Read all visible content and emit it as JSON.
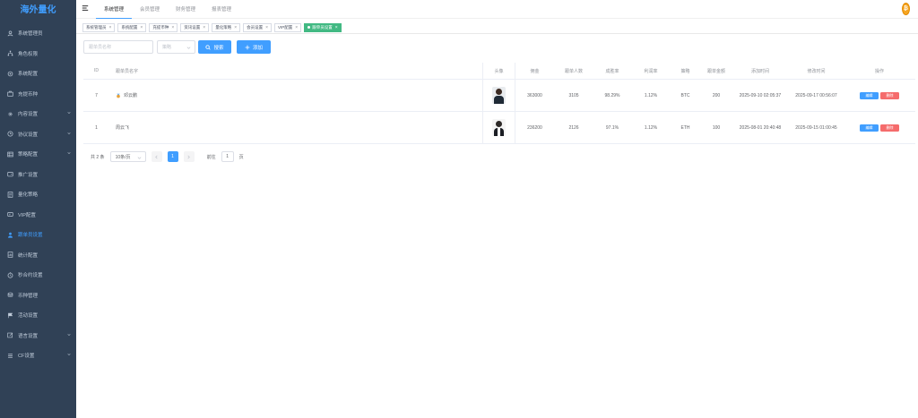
{
  "app": {
    "logo": "海外量化"
  },
  "sidebar": {
    "items": [
      {
        "label": "系统管理员",
        "icon": "user-icon"
      },
      {
        "label": "角色权限",
        "icon": "sitemap-icon"
      },
      {
        "label": "系统配置",
        "icon": "settings-icon"
      },
      {
        "label": "充提币种",
        "icon": "briefcase-icon"
      },
      {
        "label": "内容设置",
        "icon": "gear-icon"
      },
      {
        "label": "协议设置",
        "icon": "clock-icon"
      },
      {
        "label": "策略配置",
        "icon": "table-icon"
      },
      {
        "label": "推广设置",
        "icon": "wallet-icon"
      },
      {
        "label": "量化策略",
        "icon": "list-icon"
      },
      {
        "label": "VIP配置",
        "icon": "vip-icon"
      },
      {
        "label": "跟单员设置",
        "icon": "person-icon"
      },
      {
        "label": "统计配置",
        "icon": "chart-icon"
      },
      {
        "label": "秒合约设置",
        "icon": "timer-icon"
      },
      {
        "label": "币种管理",
        "icon": "coins-icon"
      },
      {
        "label": "活动设置",
        "icon": "flag-icon"
      },
      {
        "label": "语言设置",
        "icon": "edit-icon"
      },
      {
        "label": "CF设置",
        "icon": "menu-icon"
      }
    ]
  },
  "header": {
    "tabs": [
      "系统管理",
      "会员管理",
      "财务管理",
      "报表管理"
    ],
    "avatar_text": "₿"
  },
  "tags": [
    {
      "label": "系统管理员"
    },
    {
      "label": "系统配置"
    },
    {
      "label": "充提币种"
    },
    {
      "label": "资讯设置"
    },
    {
      "label": "量化策略"
    },
    {
      "label": "会员设置"
    },
    {
      "label": "VIP配置"
    },
    {
      "label": "跟单员设置"
    }
  ],
  "search": {
    "name_placeholder": "跟单员名称",
    "select_placeholder": "策略",
    "search_label": "搜索",
    "add_label": "添加"
  },
  "table": {
    "headers": {
      "id": "ID",
      "name": "跟单员名字",
      "avatar": "头像",
      "capital": "佣金",
      "followers": "跟单人数",
      "winrate": "成胜率",
      "profit": "利润率",
      "coin": "策略",
      "amount": "跟单金额",
      "added": "添加时间",
      "modified": "修改时间",
      "ops": "操作"
    },
    "rows": [
      {
        "id": "7",
        "name": "邓云鹏",
        "capital": "363000",
        "followers": "3105",
        "winrate": "98.29%",
        "profit": "1.12%",
        "coin": "BTC",
        "amount": "200",
        "added": "2025-09-10 02:05:37",
        "modified": "2025-09-17 00:56:07"
      },
      {
        "id": "1",
        "name": "周云飞",
        "capital": "236200",
        "followers": "2126",
        "winrate": "97.1%",
        "profit": "1.12%",
        "coin": "ETH",
        "amount": "100",
        "added": "2025-08-01 20:40:48",
        "modified": "2025-09-15 01:00:45"
      }
    ],
    "edit_label": "编辑",
    "delete_label": "删除"
  },
  "pager": {
    "total": "共 2 条",
    "page_size": "10条/页",
    "current": "1",
    "goto": "前往",
    "goto_value": "1",
    "page_suffix": "页"
  }
}
